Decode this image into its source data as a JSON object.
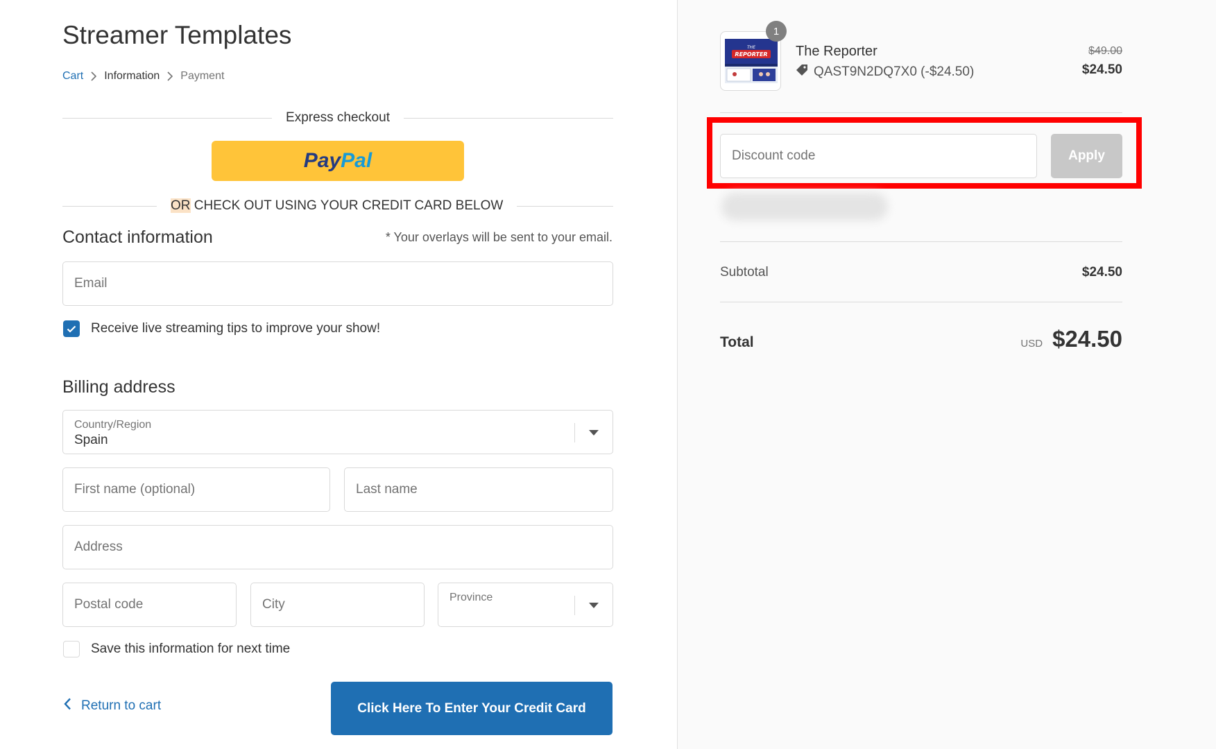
{
  "shop": {
    "title": "Streamer Templates"
  },
  "breadcrumb": {
    "cart": "Cart",
    "information": "Information",
    "payment": "Payment"
  },
  "express": {
    "label": "Express checkout",
    "paypal_part1": "Pay",
    "paypal_part2": "Pal"
  },
  "alt_checkout": {
    "or": "OR",
    "rest": " CHECK OUT USING YOUR CREDIT CARD BELOW"
  },
  "contact": {
    "title": "Contact information",
    "note": "* Your overlays will be sent to your email.",
    "email_placeholder": "Email",
    "marketing_label": "Receive live streaming tips to improve your show!"
  },
  "billing": {
    "title": "Billing address",
    "country_label": "Country/Region",
    "country_value": "Spain",
    "first_name_placeholder": "First name (optional)",
    "last_name_placeholder": "Last name",
    "address_placeholder": "Address",
    "postal_placeholder": "Postal code",
    "city_placeholder": "City",
    "province_label": "Province",
    "save_label": "Save this information for next time"
  },
  "actions": {
    "return": "Return to cart",
    "continue": "Click Here To Enter Your Credit Card"
  },
  "summary": {
    "product": {
      "quantity": "1",
      "name": "The Reporter",
      "discount": "QAST9N2DQ7X0 (-$24.50)",
      "old_price": "$49.00",
      "new_price": "$24.50",
      "thumb_text_top": "THE",
      "thumb_text": "REPORTER"
    },
    "discount_placeholder": "Discount code",
    "apply": "Apply",
    "subtotal_label": "Subtotal",
    "subtotal_value": "$24.50",
    "total_label": "Total",
    "currency": "USD",
    "total_value": "$24.50"
  },
  "colors": {
    "accent": "#1f6fb3",
    "paypal_yellow": "#ffc439",
    "highlight": "#ff0000"
  }
}
